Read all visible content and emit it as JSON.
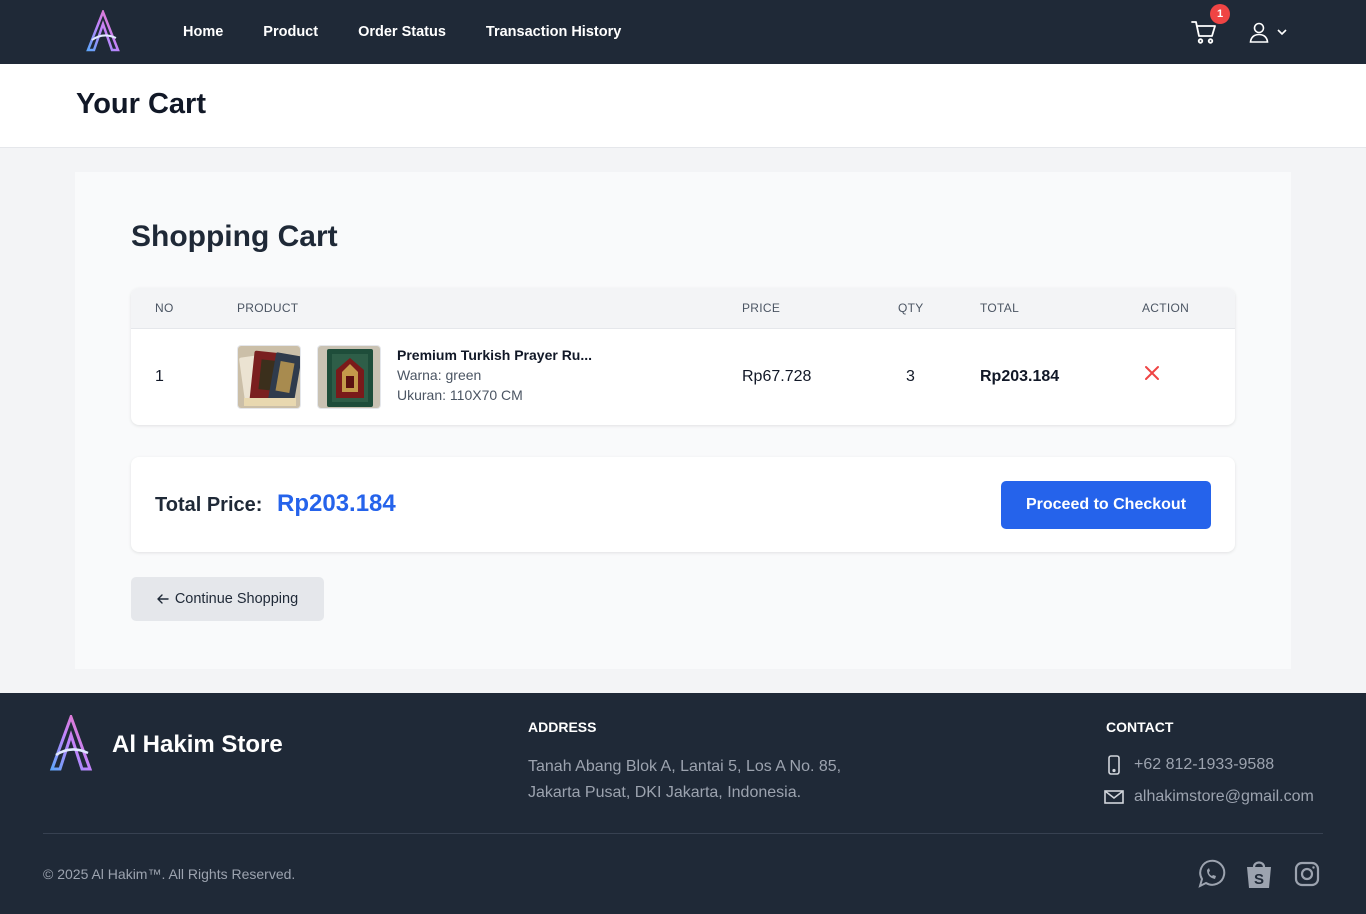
{
  "nav": {
    "links": [
      "Home",
      "Product",
      "Order Status",
      "Transaction History"
    ],
    "cart_badge": "1"
  },
  "page": {
    "title": "Your Cart"
  },
  "cart": {
    "heading": "Shopping Cart",
    "columns": [
      "NO",
      "PRODUCT",
      "PRICE",
      "QTY",
      "TOTAL",
      "ACTION"
    ],
    "items": [
      {
        "no": "1",
        "name": "Premium Turkish Prayer Ru...",
        "variant_color": "Warna: green",
        "variant_size": "Ukuran: 110X70 CM",
        "price": "Rp67.728",
        "qty": "3",
        "total": "Rp203.184"
      }
    ],
    "total_label": "Total Price:",
    "total_value": "Rp203.184",
    "checkout_label": "Proceed to Checkout",
    "continue_label": "Continue Shopping"
  },
  "footer": {
    "brand": "Al Hakim Store",
    "address_heading": "ADDRESS",
    "address_line1": "Tanah Abang Blok A, Lantai 5, Los A No. 85,",
    "address_line2": "Jakarta Pusat, DKI Jakarta, Indonesia.",
    "contact_heading": "CONTACT",
    "phone": "+62 812-1933-9588",
    "email": "alhakimstore@gmail.com",
    "copyright": "© 2025 Al Hakim™. All Rights Reserved.",
    "social_icons": [
      "whatsapp-icon",
      "shopee-icon",
      "instagram-icon"
    ]
  },
  "colors": {
    "navbar": "#1f2937",
    "accent": "#2563eb",
    "badge": "#ef4444",
    "remove": "#ef4444"
  }
}
